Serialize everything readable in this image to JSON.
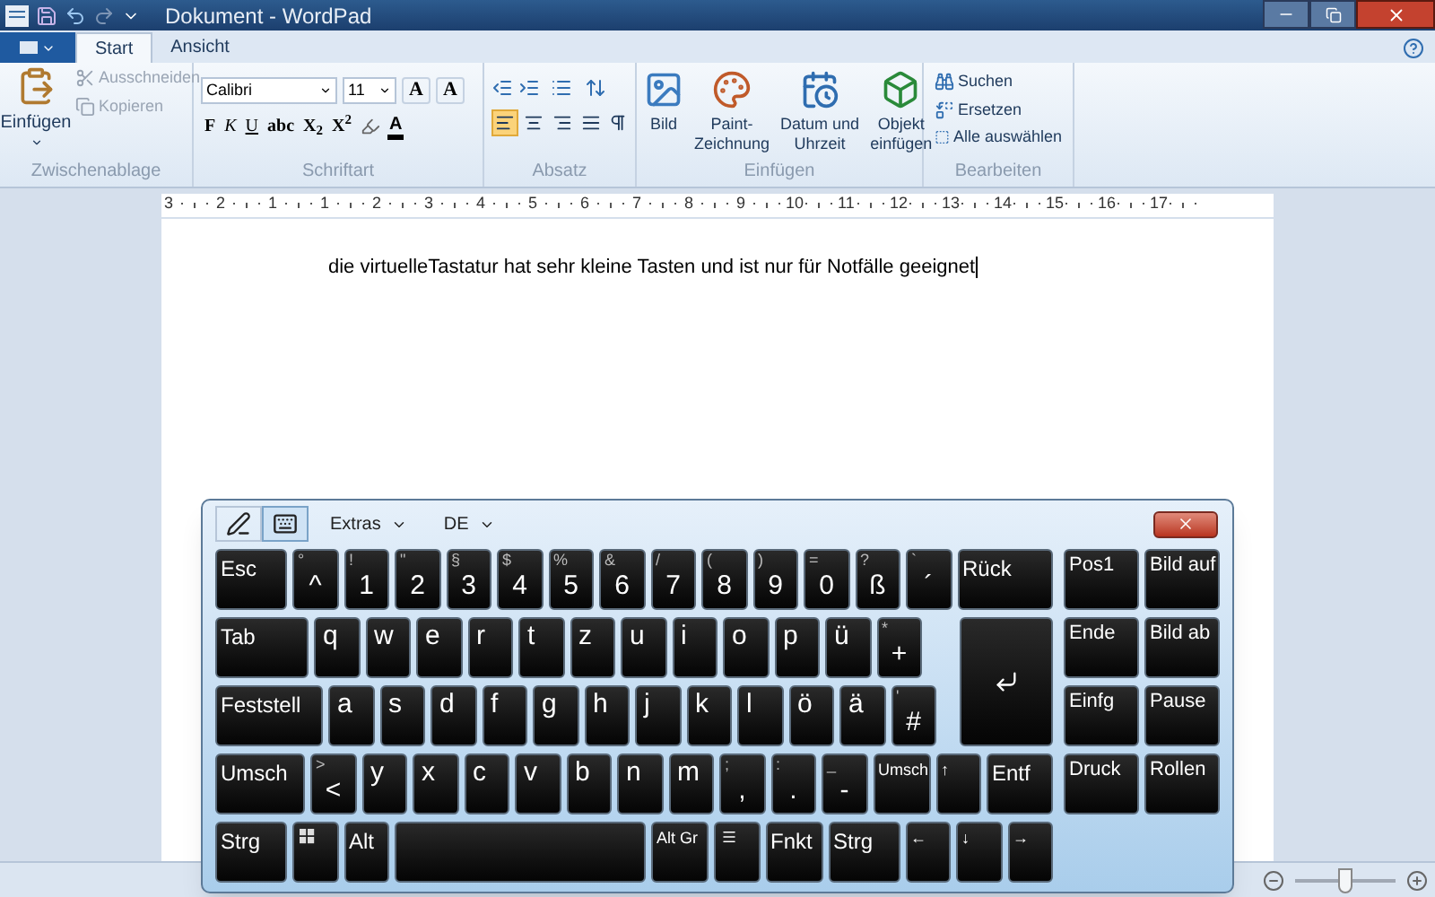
{
  "window": {
    "title": "Dokument - WordPad"
  },
  "tabs": [
    {
      "label": "Start",
      "selected": true
    },
    {
      "label": "Ansicht",
      "selected": false
    }
  ],
  "ribbon": {
    "clipboard": {
      "title": "Zwischenablage",
      "paste": "Einfügen",
      "cut": {
        "label": "Ausschneiden",
        "disabled": true
      },
      "copy": {
        "label": "Kopieren",
        "disabled": true
      }
    },
    "font": {
      "title": "Schriftart",
      "family": "Calibri",
      "size": "11",
      "size_buttons": [
        "A",
        "A"
      ],
      "format_buttons": [
        "F",
        "K",
        "U",
        "abc",
        "X$_{2}$",
        "X$^{2}$"
      ],
      "font_color": "A"
    },
    "paragraph": {
      "title": "Absatz",
      "alignments": [
        {
          "kind": "left",
          "selected": true
        },
        {
          "kind": "center",
          "selected": false
        },
        {
          "kind": "right",
          "selected": false
        },
        {
          "kind": "justify",
          "selected": false
        }
      ]
    },
    "insert": {
      "title": "Einfügen",
      "items": [
        {
          "kind": "image",
          "label": "Bild"
        },
        {
          "kind": "paint",
          "label": "Paint-\nZeichnung"
        },
        {
          "kind": "datetime",
          "label": "Datum und\nUhrzeit"
        },
        {
          "kind": "object",
          "label": "Objekt\neinfügen"
        }
      ]
    },
    "edit": {
      "title": "Bearbeiten",
      "items": [
        {
          "kind": "find",
          "label": "Suchen"
        },
        {
          "kind": "replace",
          "label": "Ersetzen"
        },
        {
          "kind": "select_all",
          "label": "Alle auswählen"
        }
      ]
    }
  },
  "ruler": [
    "3",
    "2",
    "1",
    "1",
    "2",
    "3",
    "4",
    "5",
    "6",
    "7",
    "8",
    "9",
    "10",
    "11",
    "12",
    "13",
    "14",
    "15",
    "16",
    "17"
  ],
  "document": {
    "text": "die virtuelleTastatur hat sehr kleine Tasten und ist nur für Notfälle geeignet"
  },
  "keyboard": {
    "modes": [
      {
        "kind": "pen",
        "selected": false
      },
      {
        "kind": "keys",
        "selected": true
      }
    ],
    "menus": [
      "Extras",
      "DE"
    ],
    "rows": [
      {
        "keys": [
          {
            "kind": "label",
            "main": "Esc"
          },
          {
            "kind": "char",
            "main": "^",
            "shift": "°"
          },
          {
            "kind": "char",
            "main": "1",
            "shift": "!"
          },
          {
            "kind": "char",
            "main": "2",
            "shift": "\""
          },
          {
            "kind": "char",
            "main": "3",
            "shift": "§"
          },
          {
            "kind": "char",
            "main": "4",
            "shift": "$"
          },
          {
            "kind": "char",
            "main": "5",
            "shift": "%"
          },
          {
            "kind": "char",
            "main": "6",
            "shift": "&"
          },
          {
            "kind": "char",
            "main": "7",
            "shift": "/"
          },
          {
            "kind": "char",
            "main": "8",
            "shift": "("
          },
          {
            "kind": "char",
            "main": "9",
            "shift": ")"
          },
          {
            "kind": "char",
            "main": "0",
            "shift": "="
          },
          {
            "kind": "char",
            "main": "ß",
            "shift": "?"
          },
          {
            "kind": "char",
            "main": "´",
            "shift": "`"
          },
          {
            "kind": "label",
            "main": "Rück"
          }
        ]
      },
      {
        "keys": [
          {
            "kind": "label",
            "main": "Tab"
          },
          {
            "kind": "letter",
            "main": "q"
          },
          {
            "kind": "letter",
            "main": "w"
          },
          {
            "kind": "letter",
            "main": "e"
          },
          {
            "kind": "letter",
            "main": "r"
          },
          {
            "kind": "letter",
            "main": "t"
          },
          {
            "kind": "letter",
            "main": "z"
          },
          {
            "kind": "letter",
            "main": "u"
          },
          {
            "kind": "letter",
            "main": "i"
          },
          {
            "kind": "letter",
            "main": "o"
          },
          {
            "kind": "letter",
            "main": "p"
          },
          {
            "kind": "letter",
            "main": "ü"
          },
          {
            "kind": "char",
            "main": "+",
            "shift": "*"
          }
        ]
      },
      {
        "keys": [
          {
            "kind": "label",
            "main": "Feststell"
          },
          {
            "kind": "letter",
            "main": "a"
          },
          {
            "kind": "letter",
            "main": "s"
          },
          {
            "kind": "letter",
            "main": "d"
          },
          {
            "kind": "letter",
            "main": "f"
          },
          {
            "kind": "letter",
            "main": "g"
          },
          {
            "kind": "letter",
            "main": "h"
          },
          {
            "kind": "letter",
            "main": "j"
          },
          {
            "kind": "letter",
            "main": "k"
          },
          {
            "kind": "letter",
            "main": "l"
          },
          {
            "kind": "letter",
            "main": "ö"
          },
          {
            "kind": "letter",
            "main": "ä"
          },
          {
            "kind": "char",
            "main": "#",
            "shift": "'"
          }
        ]
      },
      {
        "keys": [
          {
            "kind": "label",
            "main": "Umsch"
          },
          {
            "kind": "char",
            "main": "<",
            "shift": ">"
          },
          {
            "kind": "letter",
            "main": "y"
          },
          {
            "kind": "letter",
            "main": "x"
          },
          {
            "kind": "letter",
            "main": "c"
          },
          {
            "kind": "letter",
            "main": "v"
          },
          {
            "kind": "letter",
            "main": "b"
          },
          {
            "kind": "letter",
            "main": "n"
          },
          {
            "kind": "letter",
            "main": "m"
          },
          {
            "kind": "char",
            "main": ",",
            "shift": ";"
          },
          {
            "kind": "char",
            "main": ".",
            "shift": ":"
          },
          {
            "kind": "char",
            "main": "-",
            "shift": "_"
          },
          {
            "kind": "small",
            "main": "Umsch"
          },
          {
            "kind": "small",
            "main": "↑"
          },
          {
            "kind": "label",
            "main": "Entf"
          }
        ]
      },
      {
        "keys": [
          {
            "kind": "label",
            "main": "Strg"
          },
          {
            "kind": "windows"
          },
          {
            "kind": "label",
            "main": "Alt"
          },
          {
            "kind": "space"
          },
          {
            "kind": "small",
            "main": "Alt Gr"
          },
          {
            "kind": "menu"
          },
          {
            "kind": "label",
            "main": "Fnkt"
          },
          {
            "kind": "label",
            "main": "Strg"
          },
          {
            "kind": "small",
            "main": "←"
          },
          {
            "kind": "small",
            "main": "↓"
          },
          {
            "kind": "small",
            "main": "→"
          }
        ]
      }
    ],
    "nav": [
      "Pos1",
      "Bild auf",
      "Ende",
      "Bild ab",
      "Einfg",
      "Pause",
      "Druck",
      "Rollen"
    ]
  },
  "status_bar": {
    "zoom": {
      "level": 0.5
    }
  }
}
